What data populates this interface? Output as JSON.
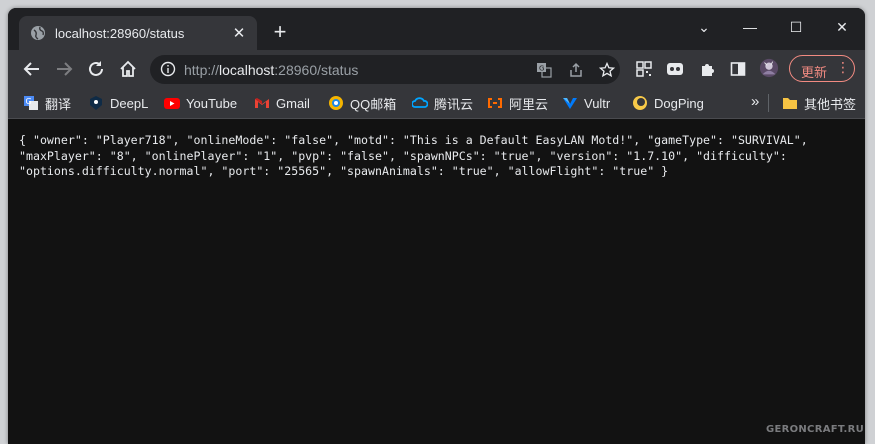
{
  "tab": {
    "title": "localhost:28960/status",
    "close_glyph": "✕"
  },
  "newtab_glyph": "+",
  "window_controls": {
    "tabsearch": "⌄",
    "minimize": "—",
    "maximize": "☐",
    "close": "✕"
  },
  "omnibox": {
    "scheme": "http://",
    "host": "localhost",
    "rest": ":28960/status"
  },
  "update_button": {
    "label": "更新",
    "menu": "⋮"
  },
  "bookmarks": {
    "items": [
      {
        "label": "翻译",
        "color": "#4c8bf5"
      },
      {
        "label": "DeepL",
        "color": "#0f2b46"
      },
      {
        "label": "YouTube",
        "color": "#ff0000"
      },
      {
        "label": "Gmail",
        "color": "#ea4335"
      },
      {
        "label": "QQ邮箱",
        "color": "#f4b400"
      },
      {
        "label": "腾讯云",
        "color": "#00a4ff"
      },
      {
        "label": "阿里云",
        "color": "#ff6a00"
      },
      {
        "label": "Vultr",
        "color": "#007bfc"
      },
      {
        "label": "DogPing",
        "color": "#f7c948"
      }
    ],
    "overflow": "»",
    "other_label": "其他书签"
  },
  "content": {
    "json_text": "{ \"owner\": \"Player718\", \"onlineMode\": \"false\", \"motd\": \"This is a Default EasyLAN Motd!\", \"gameType\": \"SURVIVAL\", \"maxPlayer\": \"8\", \"onlinePlayer\": \"1\", \"pvp\": \"false\", \"spawnNPCs\": \"true\", \"version\": \"1.7.10\", \"difficulty\": \"options.difficulty.normal\", \"port\": \"25565\", \"spawnAnimals\": \"true\", \"allowFlight\": \"true\" }"
  },
  "watermark": "GERONCRAFT.RU"
}
